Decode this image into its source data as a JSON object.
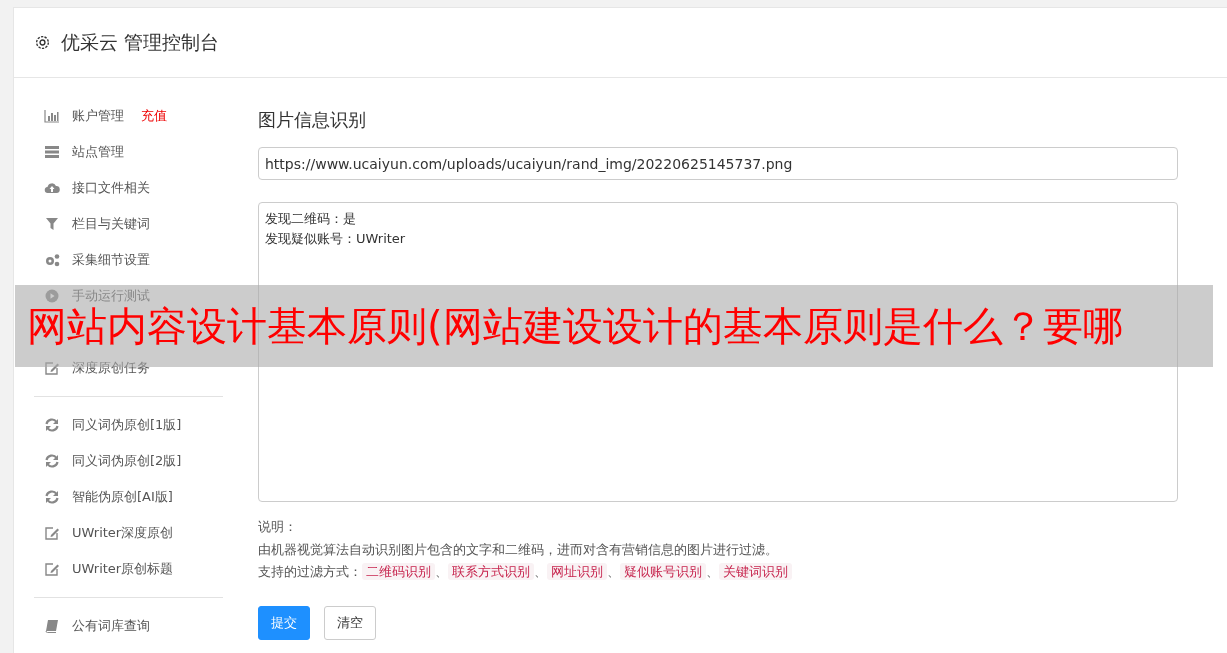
{
  "header": {
    "title": "优采云 管理控制台"
  },
  "sidebar": {
    "groups": [
      {
        "items": [
          {
            "kind": "bars",
            "label": "账户管理",
            "badge": "充值"
          },
          {
            "kind": "server",
            "label": "站点管理"
          },
          {
            "kind": "cloud",
            "label": "接口文件相关"
          },
          {
            "kind": "filter",
            "label": "栏目与关键词"
          },
          {
            "kind": "gears",
            "label": "采集细节设置"
          },
          {
            "kind": "play",
            "label": "手动运行测试"
          },
          {
            "kind": "covered"
          },
          {
            "kind": "edit",
            "label": "深度原创任务"
          }
        ]
      },
      {
        "items": [
          {
            "kind": "refresh",
            "label": "同义词伪原创[1版]"
          },
          {
            "kind": "refresh",
            "label": "同义词伪原创[2版]"
          },
          {
            "kind": "refresh",
            "label": "智能伪原创[AI版]"
          },
          {
            "kind": "edit",
            "label": "UWriter深度原创"
          },
          {
            "kind": "edit",
            "label": "UWriter原创标题"
          }
        ]
      },
      {
        "items": [
          {
            "kind": "book",
            "label": "公有词库查询"
          }
        ]
      }
    ]
  },
  "main": {
    "title": "图片信息识别",
    "url_field": {
      "value": "https://www.ucaiyun.com/uploads/ucaiyun/rand_img/20220625145737.png"
    },
    "result_box": {
      "lines": [
        "发现二维码：是",
        "发现疑似账号：UWriter"
      ]
    },
    "notes": {
      "heading": "说明：",
      "description": "由机器视觉算法自动识别图片包含的文字和二维码，进而对含有营销信息的图片进行过滤。",
      "methods_label": "支持的过滤方式：",
      "separator": "、",
      "methods": [
        "二维码识别",
        "联系方式识别",
        "网址识别",
        "疑似账号识别",
        "关键词识别"
      ]
    },
    "buttons": [
      {
        "label": "提交",
        "kind": "primary"
      },
      {
        "label": "清空",
        "kind": "default"
      }
    ]
  },
  "overlay_banner": {
    "text": "网站内容设计基本原则(网站建设设计的基本原则是什么？要哪"
  }
}
